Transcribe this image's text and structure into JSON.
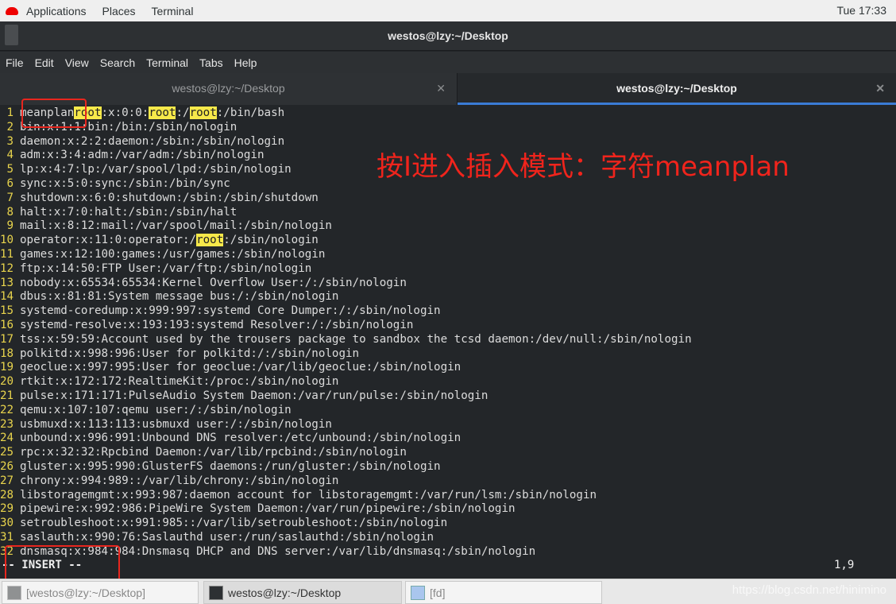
{
  "topbar": {
    "applications": "Applications",
    "places": "Places",
    "terminal": "Terminal",
    "clock": "Tue 17:33"
  },
  "window": {
    "title": "westos@lzy:~/Desktop"
  },
  "menu": [
    "File",
    "Edit",
    "View",
    "Search",
    "Terminal",
    "Tabs",
    "Help"
  ],
  "tabs": [
    {
      "label": "westos@lzy:~/Desktop",
      "active": false
    },
    {
      "label": "westos@lzy:~/Desktop",
      "active": true
    }
  ],
  "search_highlight": "root",
  "lines": [
    "meanplanroot:x:0:0:root:/root:/bin/bash",
    "bin:x:1:1:bin:/bin:/sbin/nologin",
    "daemon:x:2:2:daemon:/sbin:/sbin/nologin",
    "adm:x:3:4:adm:/var/adm:/sbin/nologin",
    "lp:x:4:7:lp:/var/spool/lpd:/sbin/nologin",
    "sync:x:5:0:sync:/sbin:/bin/sync",
    "shutdown:x:6:0:shutdown:/sbin:/sbin/shutdown",
    "halt:x:7:0:halt:/sbin:/sbin/halt",
    "mail:x:8:12:mail:/var/spool/mail:/sbin/nologin",
    "operator:x:11:0:operator:/root:/sbin/nologin",
    "games:x:12:100:games:/usr/games:/sbin/nologin",
    "ftp:x:14:50:FTP User:/var/ftp:/sbin/nologin",
    "nobody:x:65534:65534:Kernel Overflow User:/:/sbin/nologin",
    "dbus:x:81:81:System message bus:/:/sbin/nologin",
    "systemd-coredump:x:999:997:systemd Core Dumper:/:/sbin/nologin",
    "systemd-resolve:x:193:193:systemd Resolver:/:/sbin/nologin",
    "tss:x:59:59:Account used by the trousers package to sandbox the tcsd daemon:/dev/null:/sbin/nologin",
    "polkitd:x:998:996:User for polkitd:/:/sbin/nologin",
    "geoclue:x:997:995:User for geoclue:/var/lib/geoclue:/sbin/nologin",
    "rtkit:x:172:172:RealtimeKit:/proc:/sbin/nologin",
    "pulse:x:171:171:PulseAudio System Daemon:/var/run/pulse:/sbin/nologin",
    "qemu:x:107:107:qemu user:/:/sbin/nologin",
    "usbmuxd:x:113:113:usbmuxd user:/:/sbin/nologin",
    "unbound:x:996:991:Unbound DNS resolver:/etc/unbound:/sbin/nologin",
    "rpc:x:32:32:Rpcbind Daemon:/var/lib/rpcbind:/sbin/nologin",
    "gluster:x:995:990:GlusterFS daemons:/run/gluster:/sbin/nologin",
    "chrony:x:994:989::/var/lib/chrony:/sbin/nologin",
    "libstoragemgmt:x:993:987:daemon account for libstoragemgmt:/var/run/lsm:/sbin/nologin",
    "pipewire:x:992:986:PipeWire System Daemon:/var/run/pipewire:/sbin/nologin",
    "setroubleshoot:x:991:985::/var/lib/setroubleshoot:/sbin/nologin",
    "saslauth:x:990:76:Saslauthd user:/run/saslauthd:/sbin/nologin",
    "dnsmasq:x:984:984:Dnsmasq DHCP and DNS server:/var/lib/dnsmasq:/sbin/nologin"
  ],
  "status": {
    "mode": "-- INSERT --",
    "position": "1,9"
  },
  "annotation": "按I进入插入模式：字符meanplan",
  "taskbar": [
    {
      "label": "[westos@lzy:~/Desktop]"
    },
    {
      "label": "westos@lzy:~/Desktop"
    },
    {
      "label": "[fd]"
    }
  ],
  "watermark": "https://blog.csdn.net/hinimino",
  "colors": {
    "highlight": "#f7e94a",
    "annotation": "#f0241c",
    "active_tab": "#3a7bd5"
  }
}
